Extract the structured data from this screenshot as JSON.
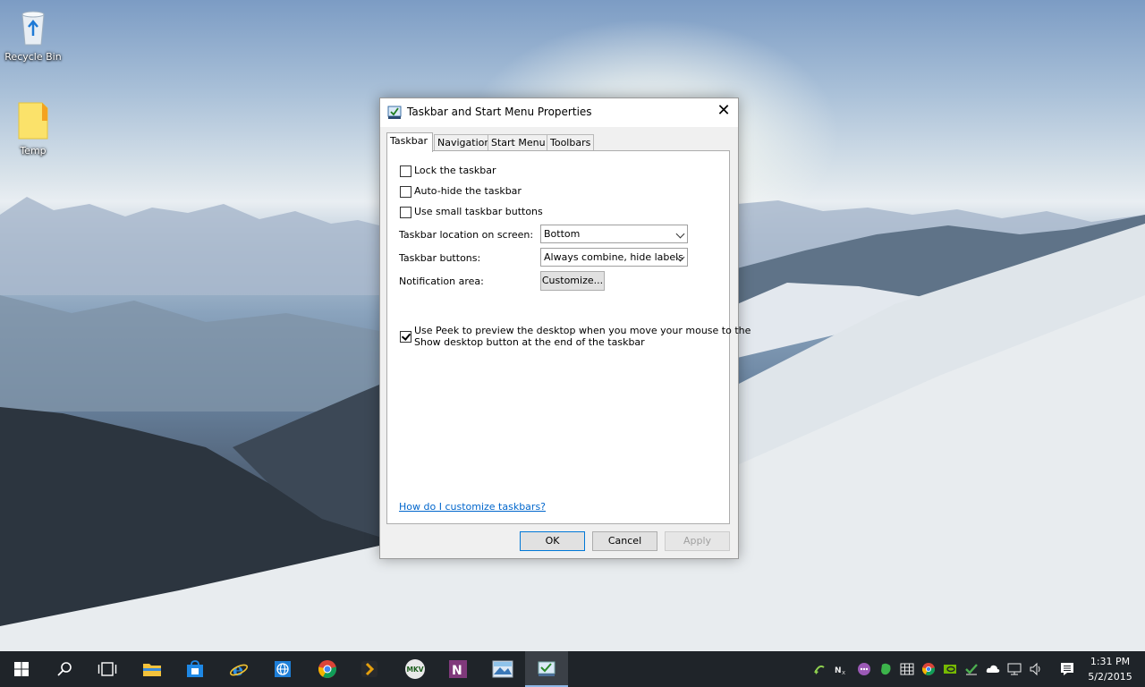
{
  "desktop": {
    "icons": [
      {
        "label": "Recycle Bin"
      },
      {
        "label": "Temp"
      }
    ]
  },
  "dialog": {
    "title": "Taskbar and Start Menu Properties",
    "close_label": "✕",
    "tabs": [
      {
        "label": "Taskbar",
        "active": true
      },
      {
        "label": "Navigation",
        "active": false
      },
      {
        "label": "Start Menu",
        "active": false
      },
      {
        "label": "Toolbars",
        "active": false
      }
    ],
    "checkboxes": [
      {
        "label": "Lock the taskbar",
        "checked": false
      },
      {
        "label": "Auto-hide the taskbar",
        "checked": false
      },
      {
        "label": "Use small taskbar buttons",
        "checked": false
      }
    ],
    "location_label": "Taskbar location on screen:",
    "location_value": "Bottom",
    "buttons_label": "Taskbar buttons:",
    "buttons_value": "Always combine, hide labels",
    "notification_label": "Notification area:",
    "customize_label": "Customize...",
    "peek_line1": "Use Peek to preview the desktop when you move your mouse to the",
    "peek_line2": "Show desktop button at the end of the taskbar",
    "peek_checked": true,
    "help_link": "How do I customize taskbars?",
    "ok_label": "OK",
    "cancel_label": "Cancel",
    "apply_label": "Apply"
  },
  "taskbar": {
    "apps": [
      {
        "name": "start-icon"
      },
      {
        "name": "search-icon"
      },
      {
        "name": "task-view-icon"
      },
      {
        "name": "file-explorer-icon"
      },
      {
        "name": "store-icon"
      },
      {
        "name": "internet-explorer-icon"
      },
      {
        "name": "globe-icon"
      },
      {
        "name": "chrome-icon"
      },
      {
        "name": "plex-icon"
      },
      {
        "name": "mkv-icon"
      },
      {
        "name": "onenote-icon"
      },
      {
        "name": "photos-icon"
      },
      {
        "name": "taskbar-properties-icon"
      }
    ],
    "time": "1:31 PM",
    "date": "5/2/2015",
    "accent": "#8fb7e6"
  }
}
